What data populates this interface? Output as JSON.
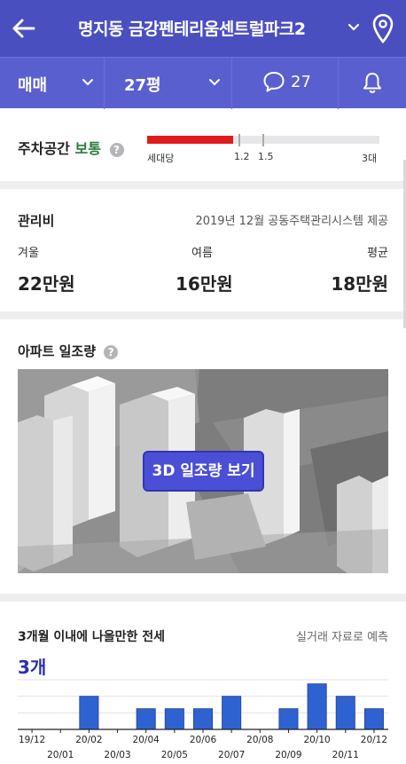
{
  "header": {
    "title": "명지동 금강펜테리움센트럴파크2",
    "back_icon": "back-arrow-icon",
    "chevron_icon": "chevron-down-icon",
    "location_icon": "map-pin-icon"
  },
  "filters": {
    "deal_type": "매매",
    "size": "27평",
    "comment_count": "27",
    "chat_icon": "chat-bubble-icon",
    "bell_icon": "bell-icon"
  },
  "parking": {
    "label": "주차공간",
    "value": "보통",
    "help": "?",
    "per_household_label": "세대당",
    "ticks": [
      "1.2",
      "1.5",
      "3대"
    ],
    "fill_fraction": 0.37,
    "bar_color": "#e01b1b"
  },
  "fee": {
    "title": "관리비",
    "source": "2019년 12월 공동주택관리시스템 제공",
    "columns": [
      {
        "label": "겨울",
        "value": "22만원"
      },
      {
        "label": "여름",
        "value": "16만원"
      },
      {
        "label": "평균",
        "value": "18만원"
      }
    ]
  },
  "sunlight": {
    "title": "아파트 일조량",
    "help": "?",
    "button": "3D 일조량 보기"
  },
  "jeonse": {
    "title": "3개월 이내에 나올만한 전세",
    "source": "실거래 자료로 예측",
    "count": "3개"
  },
  "chart_data": {
    "type": "bar",
    "categories": [
      "19/12",
      "20/01",
      "20/02",
      "20/03",
      "20/04",
      "20/05",
      "20/06",
      "20/07",
      "20/08",
      "20/09",
      "20/10",
      "20/11",
      "20/12"
    ],
    "values": [
      0,
      0,
      4,
      0,
      2.5,
      2.5,
      2.5,
      4,
      0,
      2.5,
      5.5,
      4,
      2.5
    ],
    "ylim": [
      0,
      6
    ],
    "bar_color": "#2f62d1",
    "grid": true
  },
  "colors": {
    "header": "#4a4fc0",
    "filterbar": "#5a5fd0",
    "accent": "#2d2fb0",
    "parking_status": "#2a7b3a"
  }
}
